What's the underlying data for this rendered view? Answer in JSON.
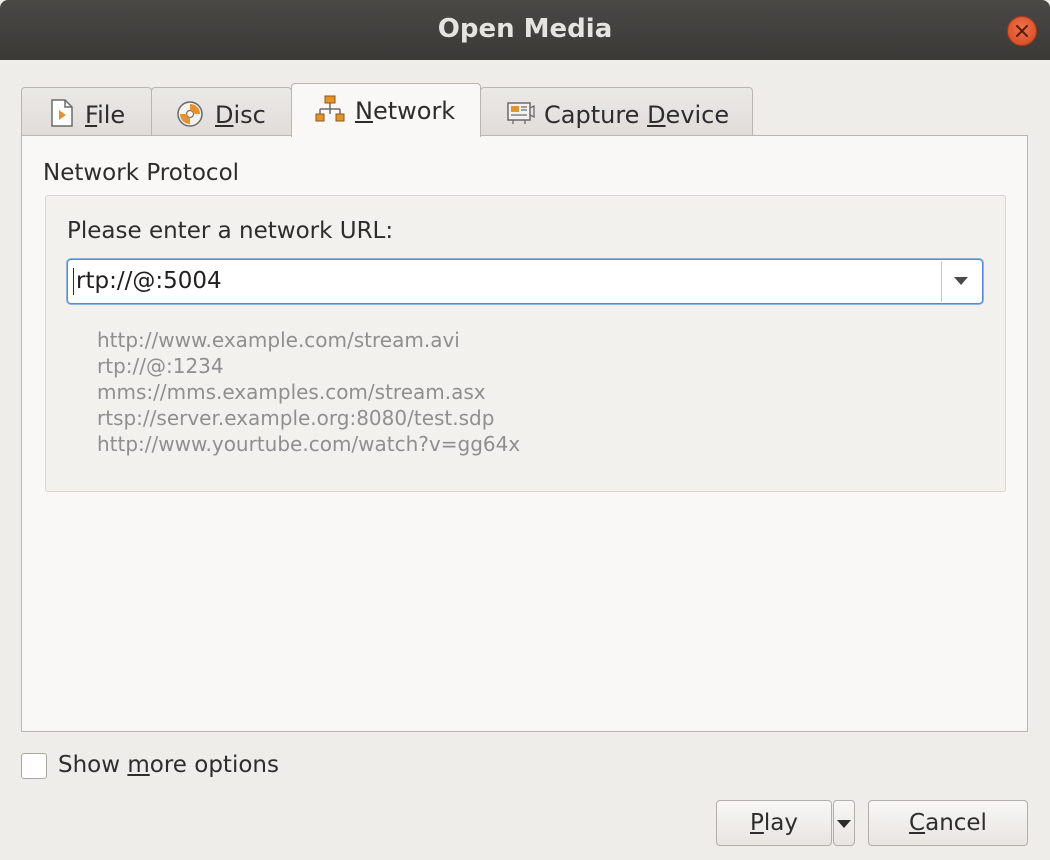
{
  "window": {
    "title": "Open Media"
  },
  "tabs": [
    {
      "pre": "",
      "mnemonic": "F",
      "post": "ile",
      "icon": "file-icon",
      "active": false
    },
    {
      "pre": "",
      "mnemonic": "D",
      "post": "isc",
      "icon": "disc-icon",
      "active": false
    },
    {
      "pre": "",
      "mnemonic": "N",
      "post": "etwork",
      "icon": "network-icon",
      "active": true
    },
    {
      "pre": "Capture ",
      "mnemonic": "D",
      "post": "evice",
      "icon": "capture-device-icon",
      "active": false
    }
  ],
  "network": {
    "group_title": "Network Protocol",
    "url_label": "Please enter a network URL:",
    "url_value": "rtp://@:5004",
    "examples": [
      "http://www.example.com/stream.avi",
      "rtp://@:1234",
      "mms://mms.examples.com/stream.asx",
      "rtsp://server.example.org:8080/test.sdp",
      "http://www.yourtube.com/watch?v=gg64x"
    ]
  },
  "options": {
    "show_more_pre": "Show ",
    "show_more_mnemonic": "m",
    "show_more_post": "ore options",
    "checked": false
  },
  "buttons": {
    "play_mnemonic": "P",
    "play_rest": "lay",
    "cancel_mnemonic": "C",
    "cancel_rest": "ancel"
  },
  "colors": {
    "titlebar": "#3a3936",
    "close": "#e0552a",
    "focus": "#4a90d9",
    "accent_icon": "#e8922a"
  }
}
